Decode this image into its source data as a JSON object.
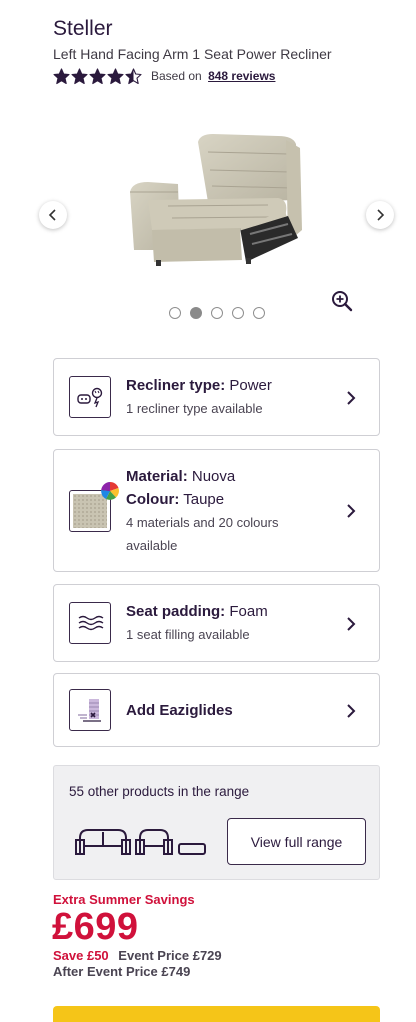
{
  "product": {
    "title": "Steller",
    "subtitle": "Left Hand Facing Arm 1 Seat Power Recliner",
    "rating_value": 4.5,
    "rating_prefix": "Based on",
    "reviews_link": "848 reviews"
  },
  "carousel": {
    "total_images": 5,
    "active_index": 1,
    "prev_icon": "chevron-left-icon",
    "next_icon": "chevron-right-icon",
    "zoom_icon": "zoom-in-icon"
  },
  "options": [
    {
      "icon": "remote-control-icon",
      "label": "Recliner type:",
      "value": "Power",
      "sub": "1 recliner type available"
    },
    {
      "icon": "fabric-swatch-icon",
      "label": "Material:",
      "value": "Nuova",
      "label2": "Colour:",
      "value2": "Taupe",
      "sub": "4 materials and 20 colours",
      "sub2": "available"
    },
    {
      "icon": "seat-padding-icon",
      "label": "Seat padding:",
      "value": "Foam",
      "sub": "1 seat filling available"
    },
    {
      "icon": "eaziglides-icon",
      "label": "Add Eaziglides"
    }
  ],
  "range": {
    "text": "55 other products in the range",
    "button": "View full range"
  },
  "pricing": {
    "promo": "Extra Summer Savings",
    "price": "£699",
    "save": "Save £50",
    "event_price": "Event Price £729",
    "after_event": "After Event Price £749"
  },
  "colors": {
    "brand_purple": "#2b1a3d",
    "sale_red": "#d0113b",
    "cta_yellow": "#f5c518"
  }
}
